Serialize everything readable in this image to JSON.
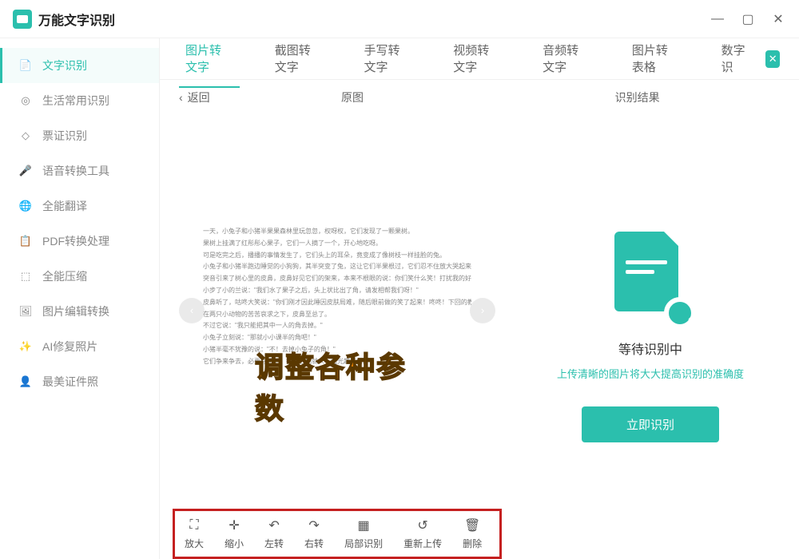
{
  "app": {
    "title": "万能文字识别"
  },
  "window_controls": {
    "minimize": "—",
    "maximize": "▢",
    "close": "✕"
  },
  "sidebar": {
    "items": [
      {
        "label": "文字识别",
        "icon": "text-icon",
        "active": true
      },
      {
        "label": "生活常用识别",
        "icon": "life-icon"
      },
      {
        "label": "票证识别",
        "icon": "ticket-icon"
      },
      {
        "label": "语音转换工具",
        "icon": "voice-icon"
      },
      {
        "label": "全能翻译",
        "icon": "translate-icon"
      },
      {
        "label": "PDF转换处理",
        "icon": "pdf-icon"
      },
      {
        "label": "全能压缩",
        "icon": "compress-icon"
      },
      {
        "label": "图片编辑转换",
        "icon": "image-edit-icon"
      },
      {
        "label": "AI修复照片",
        "icon": "ai-photo-icon"
      },
      {
        "label": "最美证件照",
        "icon": "id-photo-icon"
      }
    ]
  },
  "tabs": {
    "items": [
      {
        "label": "图片转文字",
        "active": true
      },
      {
        "label": "截图转文字"
      },
      {
        "label": "手写转文字"
      },
      {
        "label": "视频转文字"
      },
      {
        "label": "音频转文字"
      },
      {
        "label": "图片转表格"
      },
      {
        "label": "数字识"
      }
    ]
  },
  "subheader": {
    "back": "返回",
    "original": "原图",
    "result": "识别结果"
  },
  "document_lines": [
    "一天，小兔子和小猪半果果森林里玩忽忽，权呀权，它们发现了一颗果树。",
    "果树上挂满了红彤彤心果子，它们一人摘了一个，开心地吃呀。",
    "可是吃完之后，播播的事情发生了，它们头上的耳朵，竟变成了像树枝一样挂脸的兔。",
    "小兔子和小猪半跑边睡觉的小狗狗，其半突变了兔，这让它们半果根过，它们忍不住放大哭起来。",
    "突音引来了树心里的皮鼻，皮鼻好见它们的架来，本来不根眼的说：你们笑什么笑！打扰我的好梦！",
    "小步了小的兰说：\"我们水了果子之后，头上状比出了角，请发相帮我们呀！\"",
    "皮鼻听了，咕咚大笑说：\"你们刚才因此睡因皮肤局难，随后眼前做的笑了起来！咚咚！下回的教训至让你们好好记住！\"",
    "在两只小动物的苦苦哀求之下，皮鼻至总了。",
    "不过它说：\"我只能把其中一人的角去掉。\"",
    "小兔子立刻说：\"那就小小课半的角吧！\"",
    "小猪半毫不犹豫的说：\"不！去掉小兔子的角！\"",
    "它们争来争去，必要假想的，都想它们就人一起光趣了角。"
  ],
  "annotation": "调整各种参数",
  "toolbar": {
    "items": [
      {
        "label": "放大",
        "icon": "zoom-in-icon",
        "glyph": "⛶"
      },
      {
        "label": "缩小",
        "icon": "zoom-out-icon",
        "glyph": "✛"
      },
      {
        "label": "左转",
        "icon": "rotate-left-icon",
        "glyph": "↶"
      },
      {
        "label": "右转",
        "icon": "rotate-right-icon",
        "glyph": "↷"
      },
      {
        "label": "局部识别",
        "icon": "crop-icon",
        "glyph": "▦"
      },
      {
        "label": "重新上传",
        "icon": "reupload-icon",
        "glyph": "↺"
      },
      {
        "label": "删除",
        "icon": "delete-icon",
        "glyph": "🗑"
      }
    ]
  },
  "result_panel": {
    "title": "等待识别中",
    "tip": "上传清晰的图片将大大提高识别的准确度",
    "button": "立即识别"
  }
}
